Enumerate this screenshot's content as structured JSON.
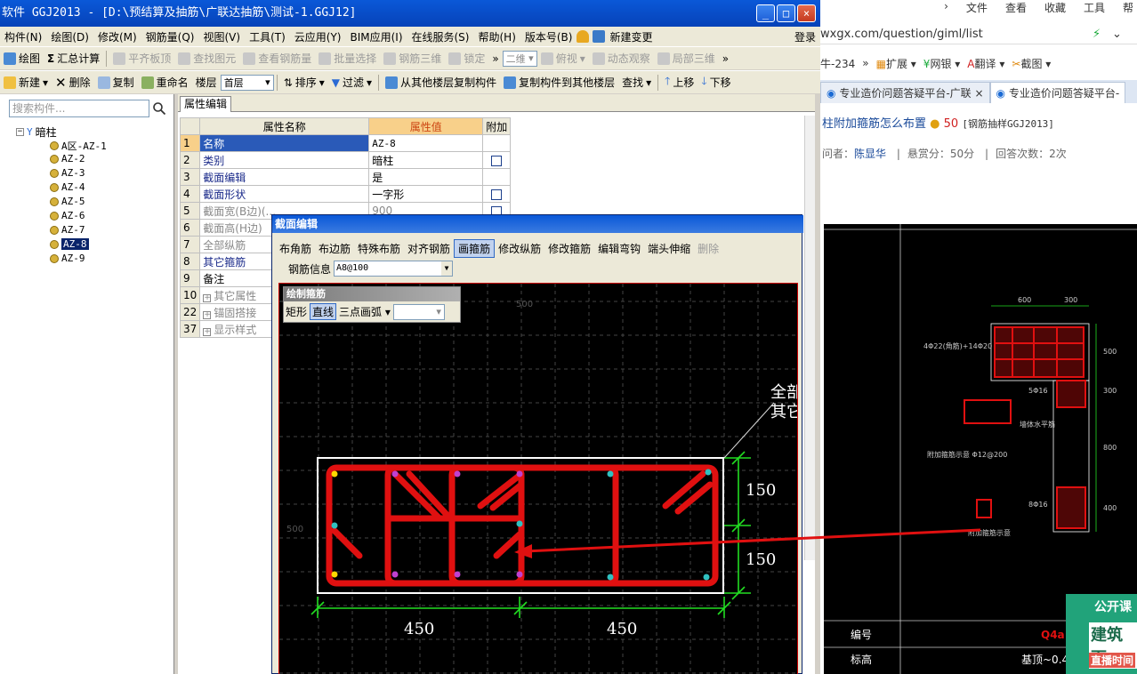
{
  "app": {
    "title": "软件 GGJ2013 - [D:\\预结算及抽筋\\广联达抽筋\\测试-1.GGJ12]",
    "menu": [
      "构件(N)",
      "绘图(D)",
      "修改(M)",
      "钢筋量(Q)",
      "视图(V)",
      "工具(T)",
      "云应用(Y)",
      "BIM应用(I)",
      "在线服务(S)",
      "帮助(H)",
      "版本号(B)",
      "新建变更"
    ],
    "login": "登录",
    "toolbar1": {
      "draw": "绘图",
      "sum": "汇总计算",
      "flat_slab": "平齐板顶",
      "find_elem": "查找图元",
      "view_rebar": "查看钢筋量",
      "batch_select": "批量选择",
      "rebar_3d": "钢筋三维",
      "lock": "锁定",
      "view_2d": "二维",
      "top_view": "俯视",
      "dynamic_view": "动态观察",
      "local_3d": "局部三维"
    },
    "toolbar2": {
      "new": "新建",
      "delete": "删除",
      "copy": "复制",
      "rename": "重命名",
      "floor_label": "楼层",
      "floor_value": "首层",
      "sort": "排序",
      "filter": "过滤",
      "copy_from": "从其他楼层复制构件",
      "copy_to": "复制构件到其他楼层",
      "find": "查找",
      "move_up": "上移",
      "move_down": "下移"
    }
  },
  "tree": {
    "search_placeholder": "搜索构件...",
    "root": "暗柱",
    "items": [
      "A区-AZ-1",
      "AZ-2",
      "AZ-3",
      "AZ-4",
      "AZ-5",
      "AZ-6",
      "AZ-7",
      "AZ-8",
      "AZ-9"
    ],
    "selected": "AZ-8"
  },
  "props": {
    "tab": "属性编辑",
    "headers": [
      "属性名称",
      "属性值",
      "附加"
    ],
    "rows": [
      {
        "num": "1",
        "name": "名称",
        "value": "AZ-8",
        "checkbox": false
      },
      {
        "num": "2",
        "name": "类别",
        "value": "暗柱",
        "checkbox": true
      },
      {
        "num": "3",
        "name": "截面编辑",
        "value": "是",
        "checkbox": false
      },
      {
        "num": "4",
        "name": "截面形状",
        "value": "一字形",
        "checkbox": true
      },
      {
        "num": "5",
        "name": "截面宽(B边)(...",
        "value": "900",
        "checkbox": true
      },
      {
        "num": "6",
        "name": "截面高(H边)",
        "value": "",
        "checkbox": false
      },
      {
        "num": "7",
        "name": "全部纵筋",
        "value": "",
        "checkbox": false
      },
      {
        "num": "8",
        "name": "其它箍筋",
        "value": "",
        "checkbox": false
      },
      {
        "num": "9",
        "name": "备注",
        "value": "",
        "checkbox": false
      },
      {
        "num": "10",
        "name": "其它属性",
        "value": "",
        "checkbox": false
      },
      {
        "num": "22",
        "name": "锚固搭接",
        "value": "",
        "checkbox": false
      },
      {
        "num": "37",
        "name": "显示样式",
        "value": "",
        "checkbox": false
      }
    ]
  },
  "dialog": {
    "title": "截面编辑",
    "tools": [
      "布角筋",
      "布边筋",
      "特殊布筋",
      "对齐钢筋",
      "画箍筋",
      "修改纵筋",
      "修改箍筋",
      "编辑弯钩",
      "端头伸缩",
      "删除"
    ],
    "active_tool": "画箍筋",
    "rebar_info_label": "钢筋信息",
    "rebar_info_value": "A8@100",
    "draw_panel": {
      "title": "绘制箍筋",
      "rect": "矩形",
      "line": "直线",
      "arc": "三点画弧"
    },
    "dims": {
      "top_right": "150",
      "bottom_right": "150",
      "left": "450",
      "right": "450",
      "grid_top": "500",
      "grid_left": "500",
      "callout1": "全部",
      "callout2": "其它"
    }
  },
  "browser": {
    "menu": [
      "文件",
      "查看",
      "收藏",
      "工具",
      "帮"
    ],
    "address": "wxgx.com/question/giml/list",
    "bookmarks": [
      "扩展",
      "网银",
      "翻译",
      "截图"
    ],
    "bookmark_prefix": "牛-234",
    "tabs": [
      "专业造价问题答疑平台-广联",
      "专业造价问题答疑平台-"
    ],
    "question_title": "柱附加箍筋怎么布置",
    "coins": "50",
    "tag": "[钢筋抽样GGJ2013]",
    "asker_label": "问者：",
    "asker": "陈显华",
    "reward": "悬赏分：50分",
    "answers": "回答次数：2次",
    "cad_labels": {
      "dim600": "600",
      "dim300": "300",
      "d500": "500",
      "d300": "300",
      "d800": "800",
      "d400": "400",
      "rebar1": "4Φ22(角筋)+14Φ20",
      "rebar2": "5Φ16",
      "rebar3": "8Φ16",
      "note1": "墙体水平筋",
      "note2": "附加箍筋示意 Φ12@200",
      "note3": "附加箍筋示意",
      "tbl1": "编号",
      "tbl2": "标高",
      "tbl2v": "基顶~0.4",
      "tbl1v": "Q4a"
    },
    "ad": {
      "line1": "公开课",
      "line2": "建筑面",
      "line3": "直播时间"
    }
  }
}
